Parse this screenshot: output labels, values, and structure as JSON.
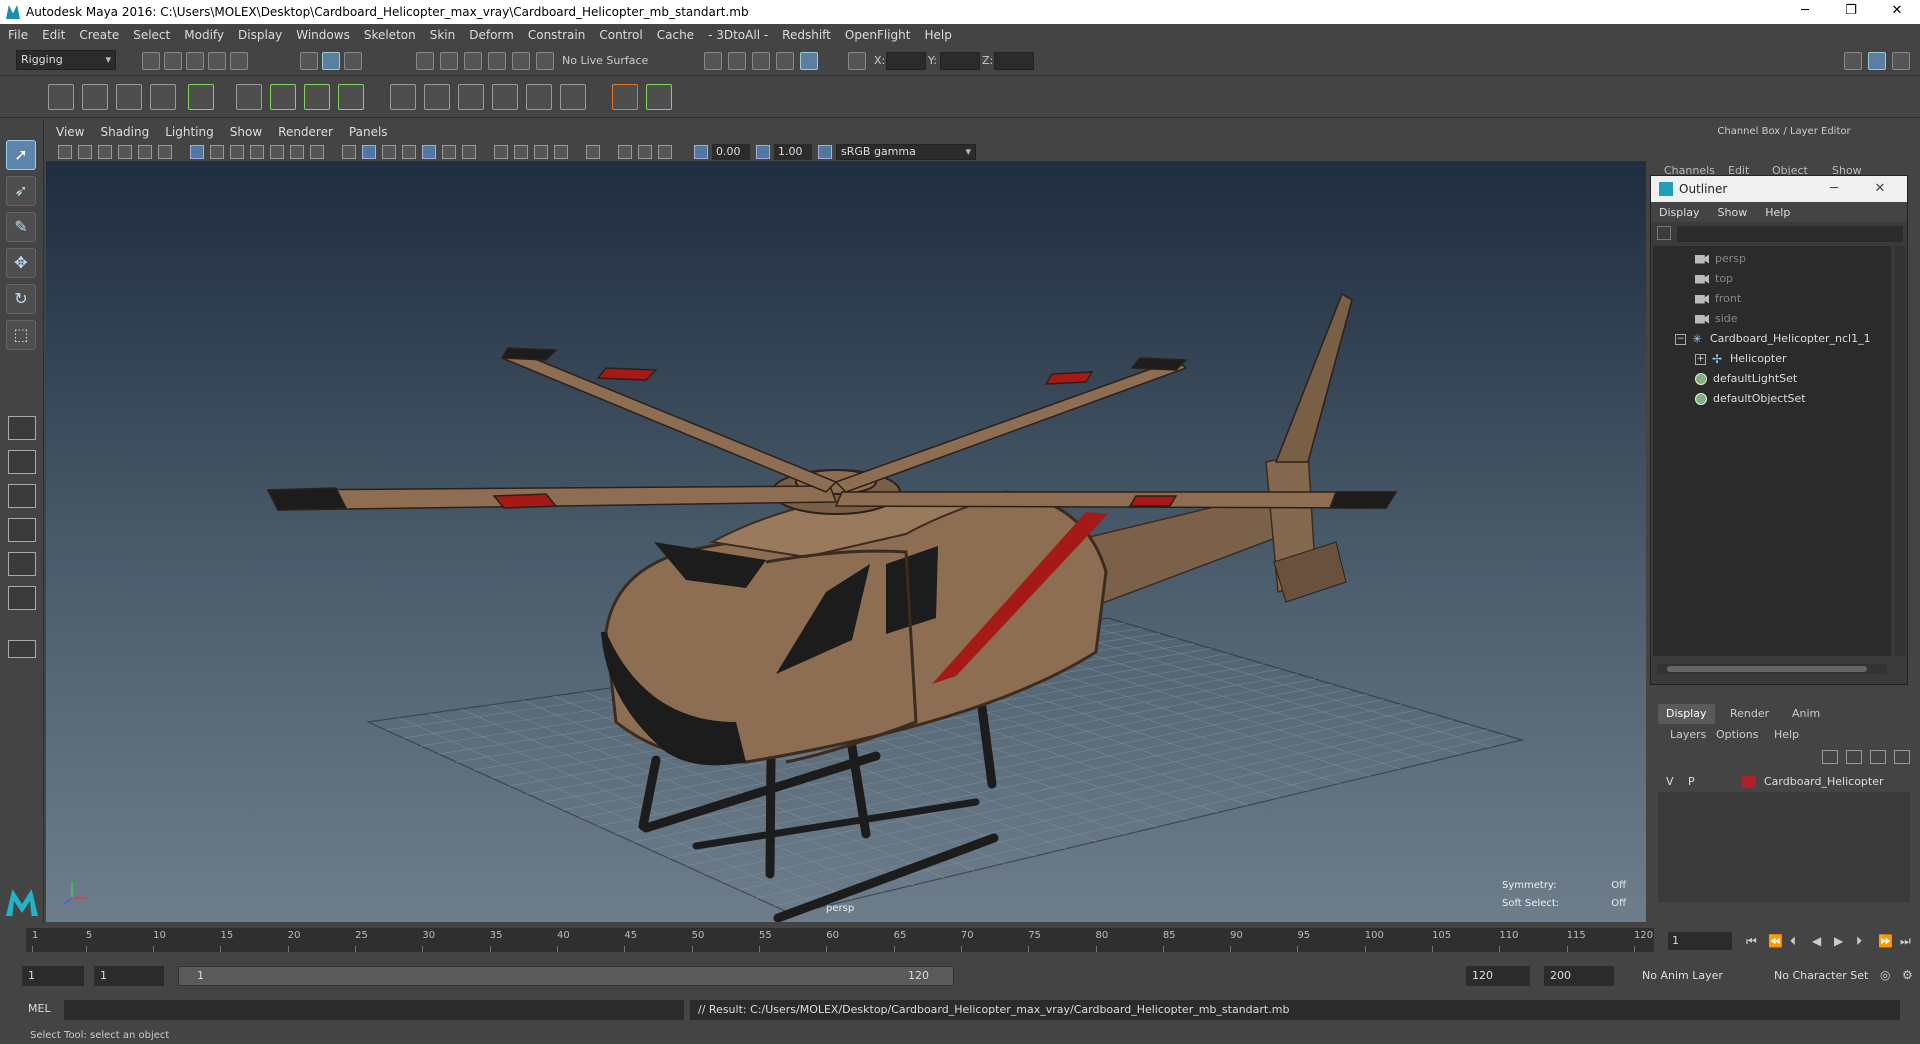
{
  "window": {
    "title": "Autodesk Maya 2016: C:\\Users\\MOLEX\\Desktop\\Cardboard_Helicopter_max_vray\\Cardboard_Helicopter_mb_standart.mb",
    "minimize": "─",
    "restore": "❐",
    "close": "✕"
  },
  "menubar": [
    "File",
    "Edit",
    "Create",
    "Select",
    "Modify",
    "Display",
    "Windows",
    "Skeleton",
    "Skin",
    "Deform",
    "Constrain",
    "Control",
    "Cache",
    "- 3DtoAll -",
    "Redshift",
    "OpenFlight",
    "Help"
  ],
  "statusline": {
    "mode": "Rigging",
    "live_surface": "No Live Surface",
    "x_label": "X:",
    "y_label": "Y:",
    "z_label": "Z:"
  },
  "panel": {
    "menus": [
      "View",
      "Shading",
      "Lighting",
      "Show",
      "Renderer",
      "Panels"
    ],
    "exposure": "0.00",
    "gamma": "1.00",
    "color_space": "sRGB gamma"
  },
  "viewport": {
    "camera": "persp",
    "symmetry_label": "Symmetry:",
    "symmetry_value": "Off",
    "soft_select_label": "Soft Select:",
    "soft_select_value": "Off",
    "colors": {
      "cardboard": "#8d6e52",
      "stripe": "#a51a16",
      "dark": "#1c1c1c"
    }
  },
  "channel_box": {
    "header": "Channel Box / Layer Editor",
    "menus": [
      "Channels",
      "Edit",
      "Object",
      "Show"
    ]
  },
  "outliner": {
    "title": "Outliner",
    "menus": [
      "Display",
      "Show",
      "Help"
    ],
    "items": [
      {
        "label": "persp",
        "icon": "camera-icon",
        "dim": true
      },
      {
        "label": "top",
        "icon": "camera-icon",
        "dim": true
      },
      {
        "label": "front",
        "icon": "camera-icon",
        "dim": true
      },
      {
        "label": "side",
        "icon": "camera-icon",
        "dim": true
      },
      {
        "label": "Cardboard_Helicopter_ncl1_1",
        "icon": "group-icon",
        "dim": false
      },
      {
        "label": "Helicopter",
        "icon": "mesh-icon",
        "dim": false
      },
      {
        "label": "defaultLightSet",
        "icon": "set-icon",
        "dim": false
      },
      {
        "label": "defaultObjectSet",
        "icon": "set-icon",
        "dim": false
      }
    ]
  },
  "layer_editor": {
    "tabs": [
      "Display",
      "Render",
      "Anim"
    ],
    "menus": [
      "Layers",
      "Options",
      "Help"
    ],
    "layer": {
      "v": "V",
      "p": "P",
      "name": "Cardboard_Helicopter",
      "color": "#b0202a"
    }
  },
  "timeline": {
    "ticks": [
      "1",
      "5",
      "10",
      "15",
      "20",
      "25",
      "30",
      "35",
      "40",
      "45",
      "50",
      "55",
      "60",
      "65",
      "70",
      "75",
      "80",
      "85",
      "90",
      "95",
      "100",
      "105",
      "110",
      "115",
      "120"
    ],
    "current_frame": "1"
  },
  "range": {
    "start": "1",
    "playback_start": "1",
    "range_start": "1",
    "range_end": "120",
    "playback_end": "120",
    "end": "200",
    "anim_layer": "No Anim Layer",
    "character_set": "No Character Set"
  },
  "command": {
    "language": "MEL",
    "result": "// Result: C:/Users/MOLEX/Desktop/Cardboard_Helicopter_max_vray/Cardboard_Helicopter_mb_standart.mb"
  },
  "help_line": "Select Tool: select an object"
}
